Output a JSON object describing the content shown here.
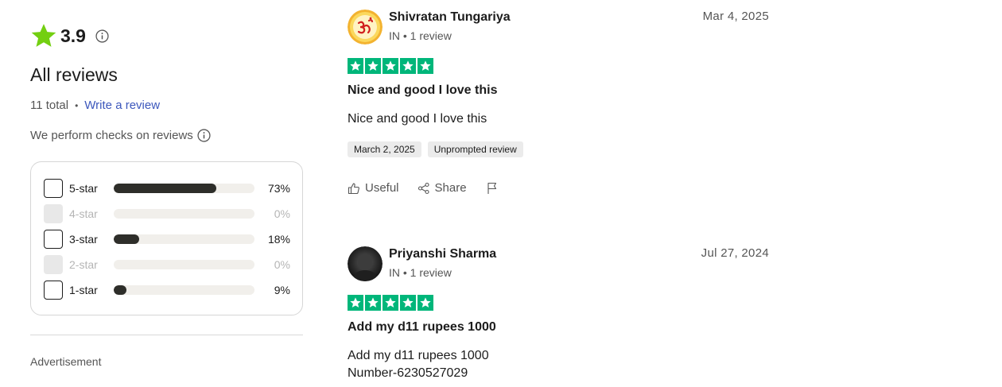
{
  "summary": {
    "rating": "3.9",
    "heading": "All reviews",
    "total": "11 total",
    "write_review": "Write a review",
    "checks_text": "We perform checks on reviews",
    "accent_color": "#73cf11"
  },
  "distribution": [
    {
      "label": "5-star",
      "percent": "73%",
      "value": 73,
      "enabled": true
    },
    {
      "label": "4-star",
      "percent": "0%",
      "value": 0,
      "enabled": false
    },
    {
      "label": "3-star",
      "percent": "18%",
      "value": 18,
      "enabled": true
    },
    {
      "label": "2-star",
      "percent": "0%",
      "value": 0,
      "enabled": false
    },
    {
      "label": "1-star",
      "percent": "9%",
      "value": 9,
      "enabled": true
    }
  ],
  "advertisement": "Advertisement",
  "reviews": [
    {
      "name": "Shivratan Tungariya",
      "meta": "IN • 1 review",
      "date": "Mar 4, 2025",
      "stars": 5,
      "title": "Nice and good I love this",
      "body": [
        "Nice and good I love this"
      ],
      "tags": [
        "March 2, 2025",
        "Unprompted review"
      ],
      "avatar_icon": "om-symbol-icon"
    },
    {
      "name": "Priyanshi Sharma",
      "meta": "IN • 1 review",
      "date": "Jul 27, 2024",
      "stars": 5,
      "title": "Add my d11 rupees 1000",
      "body": [
        "Add my d11 rupees 1000",
        "Number-6230527029"
      ],
      "tags": [],
      "avatar_icon": "profile-photo"
    }
  ],
  "actions": {
    "useful": "Useful",
    "share": "Share"
  },
  "colors": {
    "trustpilot_green": "#00b67a",
    "link_blue": "#3c57bc",
    "bar_fill": "#2e2e2a",
    "bar_track": "#f1efeb"
  }
}
